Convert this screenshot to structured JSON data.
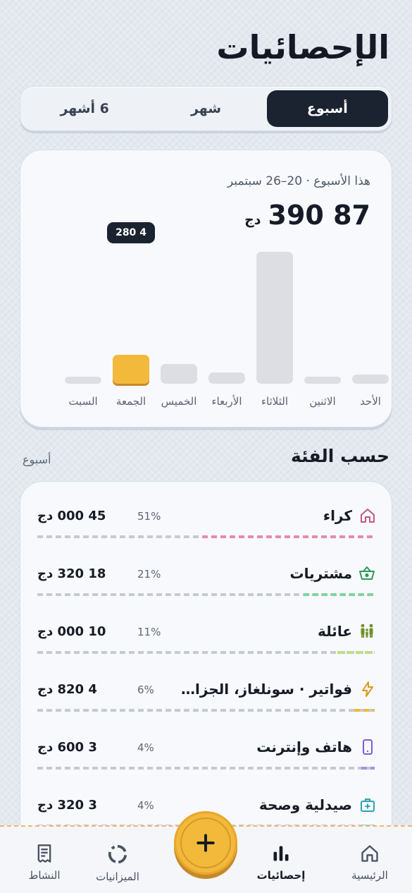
{
  "header": {
    "title": "الإحصائيات"
  },
  "period_tabs": [
    {
      "label": "أسبوع",
      "active": true
    },
    {
      "label": "شهر",
      "active": false
    },
    {
      "label": "6 أشهر",
      "active": false
    }
  ],
  "week_card": {
    "range": "هذا الأسبوع · 20–26 سبتمبر",
    "total": "87 390",
    "currency": "دج"
  },
  "chart_data": {
    "type": "bar",
    "categories": [
      "الأحد",
      "الاثنين",
      "الثلاثاء",
      "الأربعاء",
      "الخميس",
      "الجمعة",
      "السبت"
    ],
    "values": [
      1400,
      900,
      19500,
      1700,
      2900,
      4280,
      900
    ],
    "highlight_index": 5,
    "tooltip": "4 280",
    "ylim": [
      0,
      20000
    ],
    "colors": {
      "bar": "#dcdee3",
      "highlight": "#f2b93b"
    }
  },
  "categories_section": {
    "title": "حسب الفئة",
    "period": "أسبوع"
  },
  "category_rows": [
    {
      "name": "كراء",
      "icon": "home-icon",
      "pct": "51%",
      "share": 0.51,
      "amount": "45 000 دج",
      "color": "#e98aa8"
    },
    {
      "name": "مشتريات",
      "icon": "basket-icon",
      "pct": "21%",
      "share": 0.21,
      "amount": "18 320 دج",
      "color": "#7fd49a"
    },
    {
      "name": "عائلة",
      "icon": "family-icon",
      "pct": "11%",
      "share": 0.11,
      "amount": "10 000 دج",
      "color": "#bfe07a"
    },
    {
      "name": "فواتير · سونلغاز، الجزائرية للمياه",
      "icon": "bolt-icon",
      "pct": "6%",
      "share": 0.06,
      "amount": "4 820 دج",
      "color": "#f2b93b"
    },
    {
      "name": "هاتف وإنترنت",
      "icon": "phone-icon",
      "pct": "4%",
      "share": 0.04,
      "amount": "3 600 دج",
      "color": "#a88ee8"
    },
    {
      "name": "صيدلية وصحة",
      "icon": "medkit-icon",
      "pct": "4%",
      "share": 0.04,
      "amount": "3 320 دج",
      "color": "#7fd4e0"
    }
  ],
  "tabbar": {
    "home": "الرئيسية",
    "stats": "إحصائيات",
    "budgets": "الميزانيات",
    "activity": "النشاط"
  }
}
